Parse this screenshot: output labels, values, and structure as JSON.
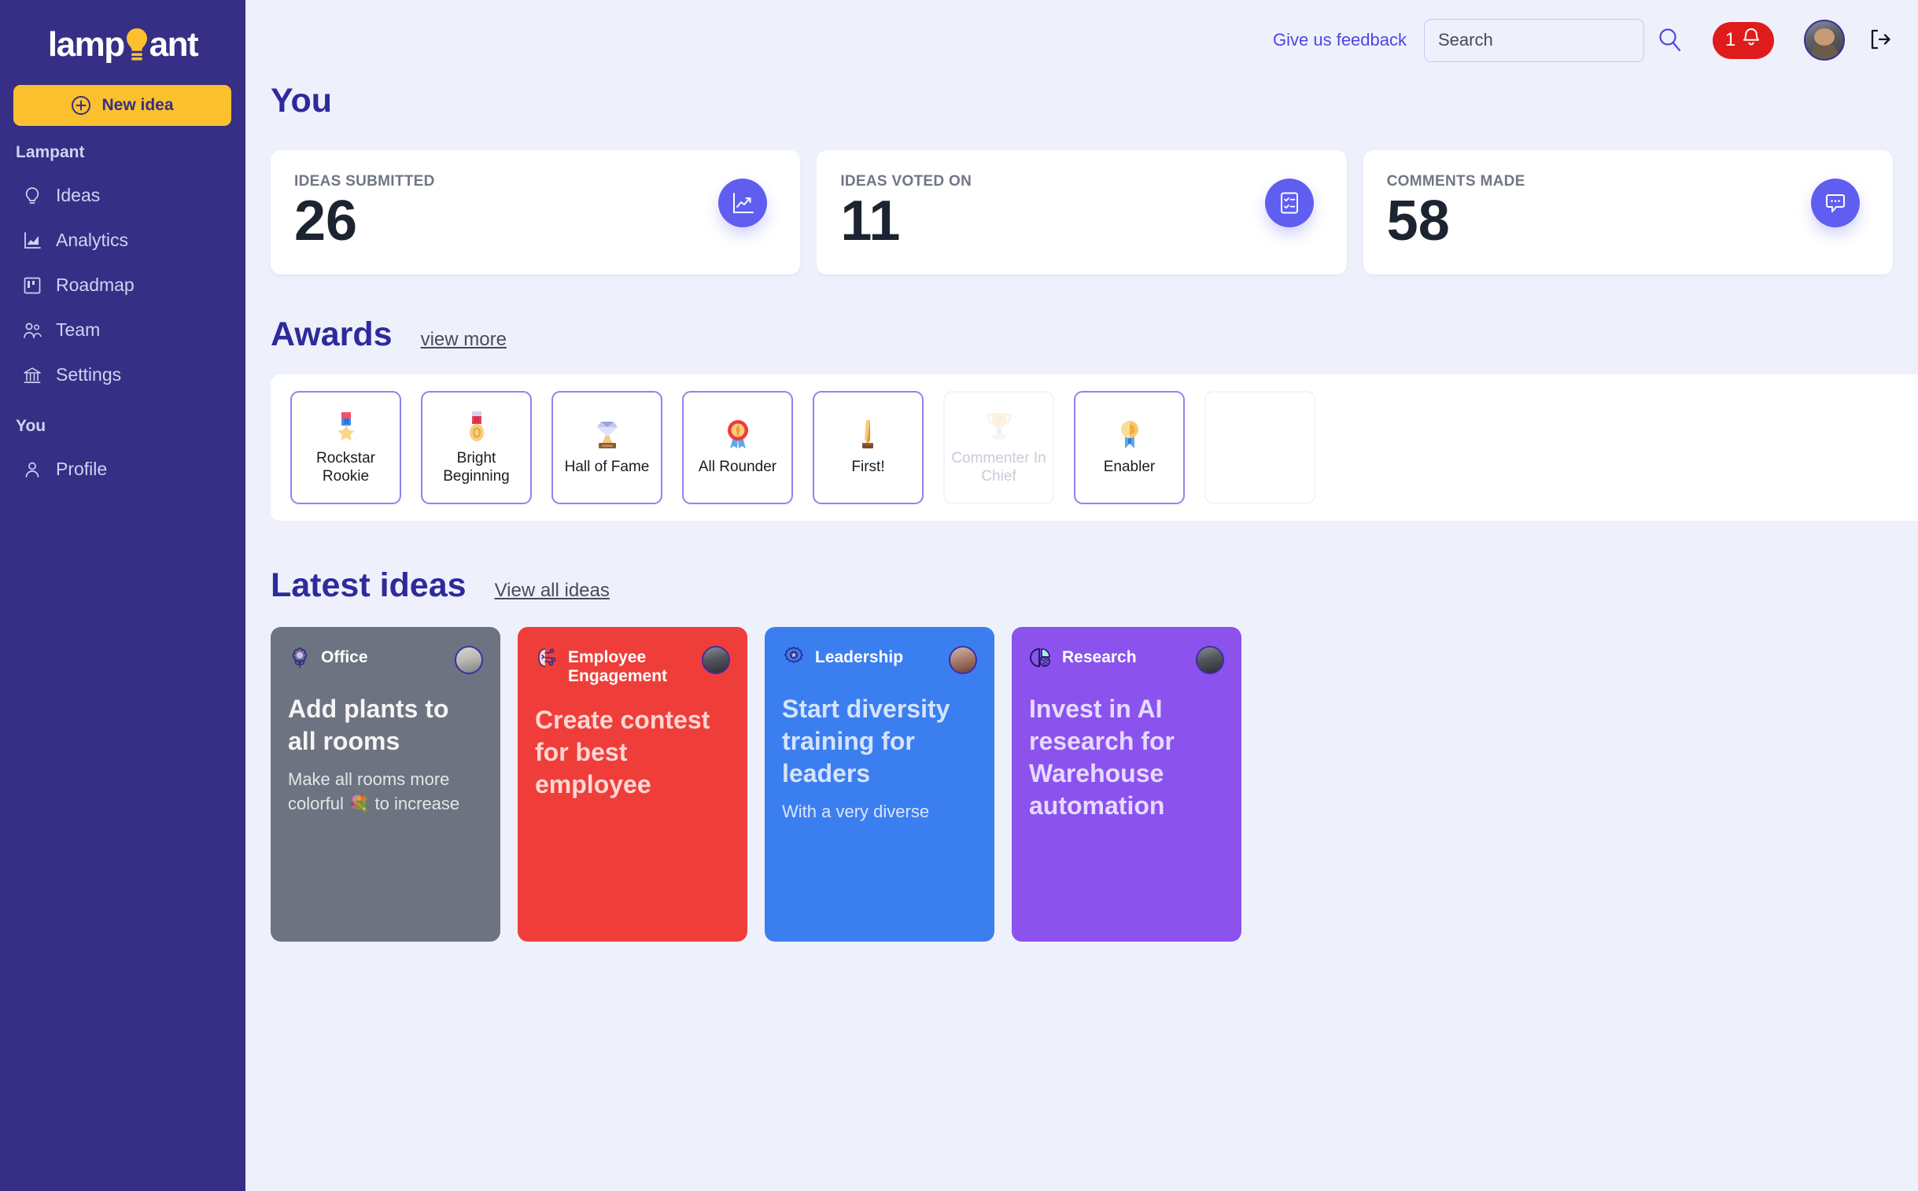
{
  "brand": {
    "logo_text_before": "lamp",
    "logo_text_after": "ant",
    "logo_icon": "lightbulb-icon",
    "primary": "#362f85",
    "accent_yellow": "#fbc02d",
    "accent_indigo": "#5f5ef0"
  },
  "sidebar": {
    "new_idea_label": "New idea",
    "sections": [
      {
        "label": "Lampant",
        "items": [
          {
            "label": "Ideas",
            "icon": "lightbulb-icon"
          },
          {
            "label": "Analytics",
            "icon": "chart-icon"
          },
          {
            "label": "Roadmap",
            "icon": "roadmap-board-icon"
          },
          {
            "label": "Team",
            "icon": "team-people-icon"
          },
          {
            "label": "Settings",
            "icon": "bank-columns-icon"
          }
        ]
      },
      {
        "label": "You",
        "items": [
          {
            "label": "Profile",
            "icon": "person-icon"
          }
        ]
      }
    ]
  },
  "header": {
    "feedback_label": "Give us feedback",
    "search_placeholder": "Search",
    "search_value": "",
    "search_icon": "magnifier-icon",
    "notification_count": "1",
    "notification_icon": "bell-icon",
    "avatar": "user-avatar",
    "logout_icon": "logout-arrow-icon"
  },
  "you_section": {
    "title": "You",
    "stats": [
      {
        "label": "IDEAS SUBMITTED",
        "value": "26",
        "icon": "trending-up-chart-icon"
      },
      {
        "label": "IDEAS VOTED ON",
        "value": "11",
        "icon": "checklist-icon"
      },
      {
        "label": "COMMENTS MADE",
        "value": "58",
        "icon": "comment-bubble-icon"
      }
    ]
  },
  "awards_section": {
    "title": "Awards",
    "link_label": "view more",
    "awards": [
      {
        "name": "Rockstar Rookie",
        "icon": "military-medal-star-icon",
        "earned": true
      },
      {
        "name": "Bright Beginning",
        "icon": "gold-medal-icon",
        "earned": true
      },
      {
        "name": "Hall of Fame",
        "icon": "diamond-trophy-icon",
        "earned": true
      },
      {
        "name": "All Rounder",
        "icon": "rosette-award-icon",
        "earned": true
      },
      {
        "name": "First!",
        "icon": "gold-ingot-trophy-icon",
        "earned": true
      },
      {
        "name": "Commenter In Chief",
        "icon": "trophy-cup-icon",
        "earned": false
      },
      {
        "name": "Enabler",
        "icon": "ribbon-medal-icon",
        "earned": true
      },
      {
        "name": "",
        "icon": "award-placeholder-icon",
        "earned": false
      }
    ]
  },
  "latest_section": {
    "title": "Latest ideas",
    "link_label": "View all ideas",
    "ideas": [
      {
        "category": "Office",
        "category_icon": "flower-icon",
        "title": "Add plants to all rooms",
        "description": "Make all rooms more colorful 💐 to increase",
        "color": "#6d7380",
        "avatar": "author-avatar-1"
      },
      {
        "category": "Employee Engagement",
        "category_icon": "brain-circuit-icon",
        "title": "Create contest for best employee",
        "description": "",
        "color": "#ef3e3a",
        "avatar": "author-avatar-2"
      },
      {
        "category": "Leadership",
        "category_icon": "badge-star-icon",
        "title": "Start diversity training for leaders",
        "description": "With a very diverse",
        "color": "#3b7ef0",
        "avatar": "author-avatar-3"
      },
      {
        "category": "Research",
        "category_icon": "pie-chart-icon",
        "title": "Invest in AI research for Warehouse automation",
        "description": "",
        "color": "#8b52ee",
        "avatar": "author-avatar-4"
      }
    ]
  }
}
